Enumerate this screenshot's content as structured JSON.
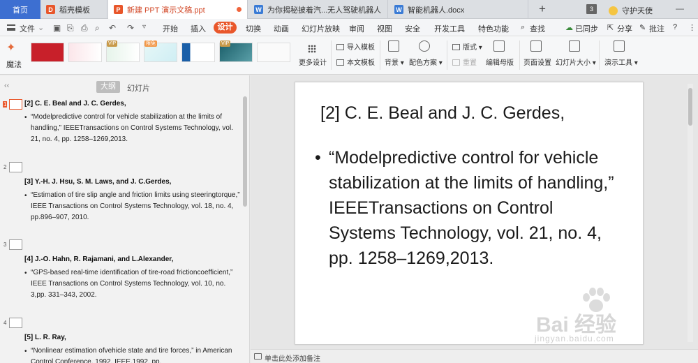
{
  "tabs": {
    "home": "首页",
    "items": [
      {
        "label": "稻壳模板",
        "icon": "daoke-icon"
      },
      {
        "label": "新建 PPT 演示文稿.ppt",
        "icon": "ppt-icon",
        "active": true
      },
      {
        "label": "为你揭秘披着汽...无人驾驶机器人",
        "icon": "word-icon"
      },
      {
        "label": "智能机器人.docx",
        "icon": "word-icon"
      }
    ],
    "add": "+",
    "window_count": "3",
    "guardian": "守护天使"
  },
  "menu": {
    "file": "文件",
    "items": [
      "开始",
      "插入",
      "设计",
      "切换",
      "动画",
      "幻灯片放映",
      "审阅",
      "视图",
      "安全",
      "开发工具",
      "特色功能"
    ],
    "active": "设计",
    "search": "查找",
    "synced": "已同步",
    "share": "分享",
    "comment": "批注"
  },
  "ribbon": {
    "magic": "魔法",
    "vip": "VIP",
    "limited": "限免",
    "more_design": "更多设计",
    "import_template": "导入模板",
    "text_template": "本文模板",
    "background": "背景",
    "color_scheme": "配色方案",
    "layout": "版式",
    "reset": "重置",
    "edit_master": "编辑母版",
    "page_setup": "页面设置",
    "slide_size": "幻灯片大小",
    "present_tools": "演示工具"
  },
  "outline": {
    "tab_outline": "大纲",
    "tab_slides": "幻灯片",
    "entries": [
      {
        "num": "1",
        "title": "[2] C. E. Beal and J. C. Gerdes,",
        "body": "“Modelpredictive control for vehicle stabilization at the limits of handling,” IEEETransactions on Control Systems Technology, vol. 21, no. 4, pp. 1258–1269,2013."
      },
      {
        "num": "2",
        "title": "[3] Y.-H. J. Hsu, S. M. Laws, and J. C.Gerdes,",
        "body": " “Estimation of tire slip angle and friction limits using steeringtorque,” IEEE Transactions on Control Systems Technology, vol. 18, no. 4, pp.896–907, 2010."
      },
      {
        "num": "3",
        "title": "[4] J.-O. Hahn, R. Rajamani, and L.Alexander,",
        "body": " “GPS-based real-time identification of tire-road frictioncoefficient,” IEEE Transactions on Control Systems Technology, vol. 10, no. 3,pp. 331–343, 2002."
      },
      {
        "num": "4",
        "title": "[5] L. R. Ray,",
        "body": "“Nonlinear estimation ofvehicle state and tire forces,” in American Control Conference, 1992. IEEE,1992, pp."
      }
    ]
  },
  "slide": {
    "title": "[2] C. E. Beal and J. C. Gerdes,",
    "bullet": "•",
    "body": "“Modelpredictive control for vehicle stabilization at the limits of handling,” IEEETransactions on Control Systems Technology, vol. 21, no. 4, pp. 1258–1269,2013."
  },
  "notes": "单击此处添加备注",
  "watermark": {
    "main": "Bai 经验",
    "sub": "jingyan.baidu.com"
  },
  "colors": {
    "accent": "#e9572b",
    "home_tab": "#3d6fd1"
  }
}
